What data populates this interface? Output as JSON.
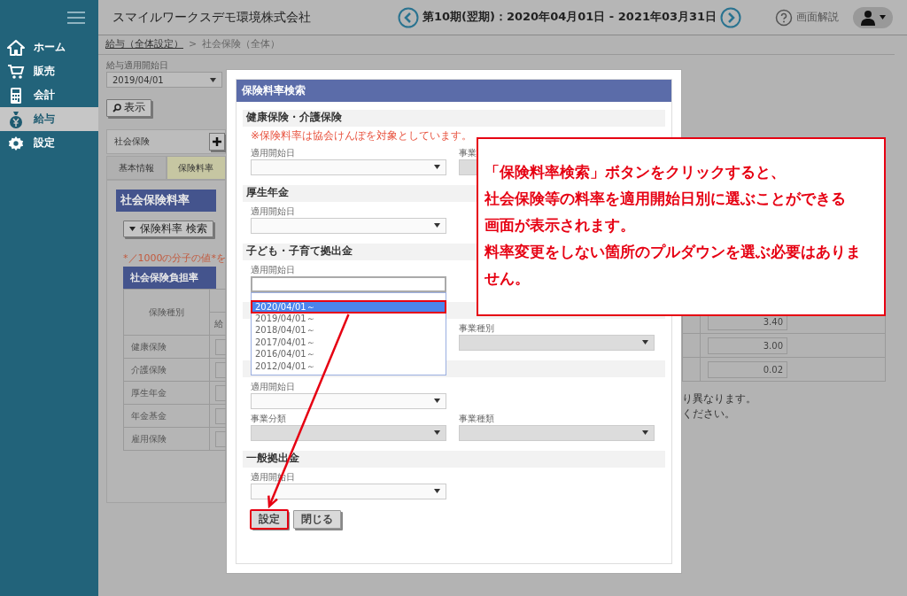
{
  "sidebar": {
    "items": [
      {
        "label": "ホーム",
        "selected": false
      },
      {
        "label": "販売",
        "selected": false
      },
      {
        "label": "会計",
        "selected": false
      },
      {
        "label": "給与",
        "selected": true
      },
      {
        "label": "設定",
        "selected": false
      }
    ]
  },
  "header": {
    "company": "スマイルワークスデモ環境株式会社",
    "period": "第10期(翌期)：2020年04月01日 - 2021年03月31日",
    "help": "画面解説"
  },
  "breadcrumb": {
    "items": [
      {
        "label": "給与（全体設定）",
        "link": true
      },
      {
        "label": "社会保険（全体）",
        "link": false
      }
    ],
    "separator": ">"
  },
  "page": {
    "start_label": "給与適用開始日",
    "start_value": "2019/04/01",
    "show_button": "表示",
    "panel_title": "社会保険",
    "tabs": [
      {
        "label": "基本情報",
        "selected": false
      },
      {
        "label": "保険料率",
        "selected": true
      }
    ],
    "card_title": "社会保険料率",
    "search_button": "保険料率 検索",
    "note": "*／1000の分子の値*を",
    "table": {
      "title": "社会保険負担率",
      "column_1": "保険種別",
      "column_2": "給",
      "rows": [
        "健康保険",
        "介護保険",
        "厚生年金",
        "年金基金",
        "雇用保険"
      ]
    },
    "right_values": [
      "3.40",
      "3.00",
      "0.02"
    ],
    "right_notes": [
      "り異なります。",
      "ください。"
    ]
  },
  "modal": {
    "title": "保険料率検索",
    "sections": [
      {
        "title": "健康保険・介護保険",
        "note": "※保険料率は協会けんぽを対象としています。",
        "rows": [
          {
            "left": {
              "label": "適用開始日",
              "disabled": false
            },
            "right": {
              "label": "事業",
              "disabled": true
            }
          }
        ]
      },
      {
        "title": "厚生年金",
        "rows": [
          {
            "left": {
              "label": "適用開始日",
              "disabled": false
            }
          }
        ]
      },
      {
        "title": "子ども・子育て拠出金",
        "rows": [
          {
            "left": {
              "label": "適用開始日",
              "disabled": false,
              "open": true,
              "options": [
                {
                  "label": "2020/04/01～",
                  "selected": true
                },
                {
                  "label": "2019/04/01～",
                  "selected": false
                },
                {
                  "label": "2018/04/01～",
                  "selected": false
                },
                {
                  "label": "2017/04/01～",
                  "selected": false
                },
                {
                  "label": "2016/04/01～",
                  "selected": false
                },
                {
                  "label": "2012/04/01～",
                  "selected": false
                }
              ]
            }
          }
        ]
      },
      {
        "rows": [
          {
            "right": {
              "label": "事業種別",
              "disabled": true
            }
          }
        ]
      },
      {
        "rows": [
          {
            "left": {
              "label": "適用開始日",
              "disabled": false
            }
          },
          {
            "left": {
              "label": "事業分類",
              "disabled": true
            },
            "right": {
              "label": "事業種類",
              "disabled": true
            }
          }
        ]
      },
      {
        "title": "一般拠出金",
        "rows": [
          {
            "left": {
              "label": "適用開始日",
              "disabled": false
            }
          }
        ]
      }
    ],
    "buttons": [
      {
        "label": "設定",
        "highlighted": true
      },
      {
        "label": "閉じる",
        "highlighted": false
      }
    ]
  },
  "callout": {
    "lines": [
      "「保険料率検索」ボタンをクリックすると、",
      "社会保険等の料率を適用開始日別に選ぶことができる",
      "画面が表示されます。",
      "料率変更をしない箇所のプルダウンを選ぶ必要はありません。"
    ]
  }
}
